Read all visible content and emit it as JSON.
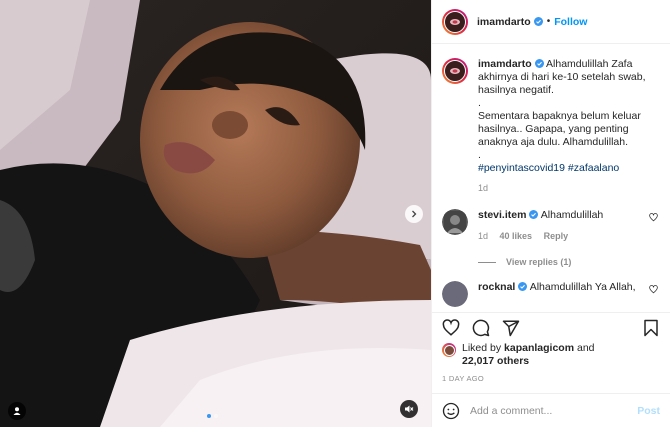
{
  "post": {
    "author": "imamdarto",
    "follow_label": "Follow",
    "separator": "•",
    "caption_lines": [
      "Alhamdulillah Zafa akhirnya di hari ke-10 setelah swab, hasilnya negatif.",
      ".",
      "Sementara bapaknya belum keluar hasilnya.. Gapapa, yang penting anaknya aja dulu. Alhamdulillah.",
      "."
    ],
    "hashtags": "#penyintascovid19 #zafaalano",
    "caption_age": "1d",
    "carousel": {
      "current": 1,
      "total": 2
    }
  },
  "comments": [
    {
      "user": "stevi.item",
      "text": "Alhamdulillah",
      "age": "1d",
      "likes": "40 likes",
      "reply": "Reply",
      "view_replies": "View replies (1)"
    },
    {
      "user": "rocknal",
      "text": "Alhamdulillah Ya Allah,"
    }
  ],
  "likes": {
    "prefix": "Liked by",
    "user": "kapanlagicom",
    "and": "and",
    "others": "22,017 others"
  },
  "date": "1 DAY AGO",
  "add_comment": {
    "placeholder": "Add a comment...",
    "post_label": "Post"
  },
  "colors": {
    "link_blue": "#0095f6",
    "verified": "#3897f0",
    "post_disabled": "#b2dffc"
  },
  "icons": [
    "chevron-right-icon",
    "user-tag-icon",
    "mute-icon",
    "verified-icon",
    "heart-icon",
    "comment-icon",
    "share-icon",
    "bookmark-icon",
    "emoji-icon"
  ]
}
